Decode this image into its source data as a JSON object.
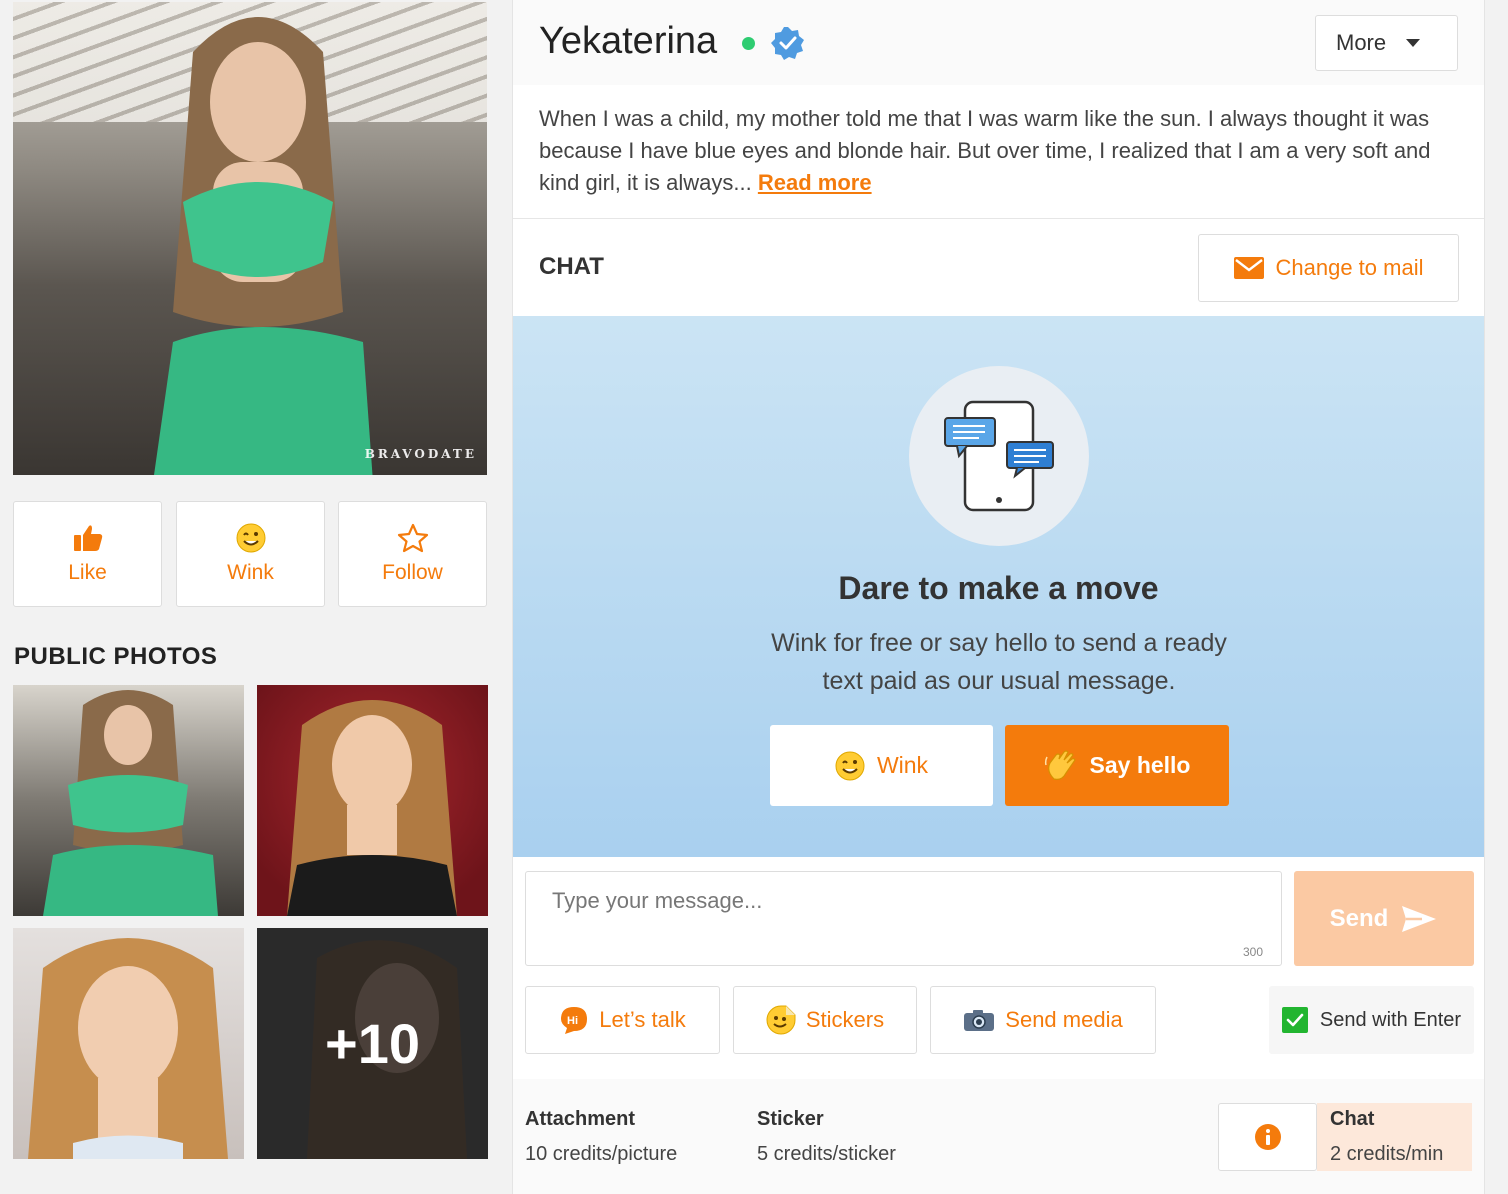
{
  "profile": {
    "name": "Yekaterina",
    "watermark": "BRAVODATE",
    "bio": "When I was a child, my mother told me that I was warm like the sun. I always thought it was because I have blue eyes and blonde hair. But over time, I realized that I am a very soft and kind girl, it is always...",
    "read_more": "Read more",
    "online_color": "#2ecc71",
    "verified_icon": "verified-badge-icon"
  },
  "actions": {
    "like": "Like",
    "wink": "Wink",
    "follow": "Follow"
  },
  "photos": {
    "title": "PUBLIC PHOTOS",
    "more_count": "+10"
  },
  "header": {
    "more": "More"
  },
  "chat": {
    "label": "CHAT",
    "change_mail": "Change to mail",
    "dare_title": "Dare to make a move",
    "dare_subtitle": "Wink for free or say hello to send a ready text paid as our usual message.",
    "wink": "Wink",
    "say_hello": "Say hello",
    "placeholder": "Type your message...",
    "char_count": "300",
    "send": "Send",
    "tools": {
      "lets_talk": "Let’s talk",
      "stickers": "Stickers",
      "send_media": "Send media"
    },
    "send_with_enter": "Send with Enter",
    "send_with_enter_checked": true
  },
  "pricing": {
    "attachment_title": "Attachment",
    "attachment_value": "10 credits/picture",
    "sticker_title": "Sticker",
    "sticker_value": "5 credits/sticker",
    "chat_title": "Chat",
    "chat_value": "2 credits/min"
  },
  "colors": {
    "accent": "#f47b0c",
    "send_disabled": "#fbc9a3",
    "chat_bg": "#b7d9f2",
    "checkbox": "#22b530"
  }
}
